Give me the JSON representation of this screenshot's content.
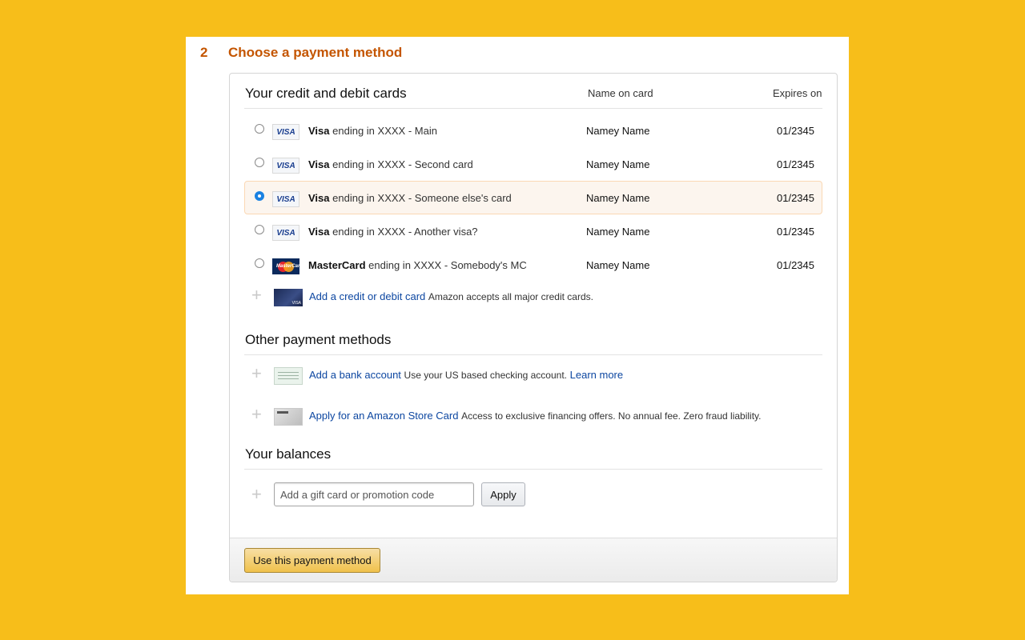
{
  "step": {
    "number": "2",
    "title": "Choose a payment method"
  },
  "cards_section": {
    "title": "Your credit and debit cards",
    "col_name": "Name on card",
    "col_expires": "Expires on",
    "cards": [
      {
        "brand": "Visa",
        "rest": "ending in XXXX - Main",
        "name": "Namey Name",
        "expires": "01/2345",
        "logo": "VISA",
        "selected": false
      },
      {
        "brand": "Visa",
        "rest": "ending in XXXX - Second card",
        "name": "Namey Name",
        "expires": "01/2345",
        "logo": "VISA",
        "selected": false
      },
      {
        "brand": "Visa",
        "rest": "ending in XXXX - Someone else's card",
        "name": "Namey Name",
        "expires": "01/2345",
        "logo": "VISA",
        "selected": true
      },
      {
        "brand": "Visa",
        "rest": "ending in XXXX - Another visa?",
        "name": "Namey Name",
        "expires": "01/2345",
        "logo": "VISA",
        "selected": false
      },
      {
        "brand": "MasterCard",
        "rest": "ending in XXXX - Somebody's MC",
        "name": "Namey Name",
        "expires": "01/2345",
        "logo": "MasterCard",
        "selected": false
      }
    ],
    "add_card_link": "Add a credit or debit card",
    "add_card_note": "Amazon accepts all major credit cards."
  },
  "other_section": {
    "title": "Other payment methods",
    "bank_link": "Add a bank account",
    "bank_note": "Use your US based checking account.",
    "learn_more": "Learn more",
    "store_link": "Apply for an Amazon Store Card",
    "store_note": "Access to exclusive financing offers. No annual fee. Zero fraud liability."
  },
  "balances_section": {
    "title": "Your balances",
    "gift_placeholder": "Add a gift card or promotion code",
    "apply_label": "Apply"
  },
  "footer": {
    "use_button": "Use this payment method"
  },
  "colors": {
    "background": "#F7BE1A",
    "step_title": "#C45500",
    "link": "#0D47A1",
    "selected_row_bg": "#FCF5EE",
    "radio_checked": "#1A82E2",
    "primary_button": "#F0C14B"
  },
  "icons": [
    "radio-icon",
    "visa-logo-icon",
    "mastercard-logo-icon",
    "plus-icon",
    "credit-card-thumb-icon",
    "bank-check-thumb-icon",
    "store-card-thumb-icon"
  ]
}
